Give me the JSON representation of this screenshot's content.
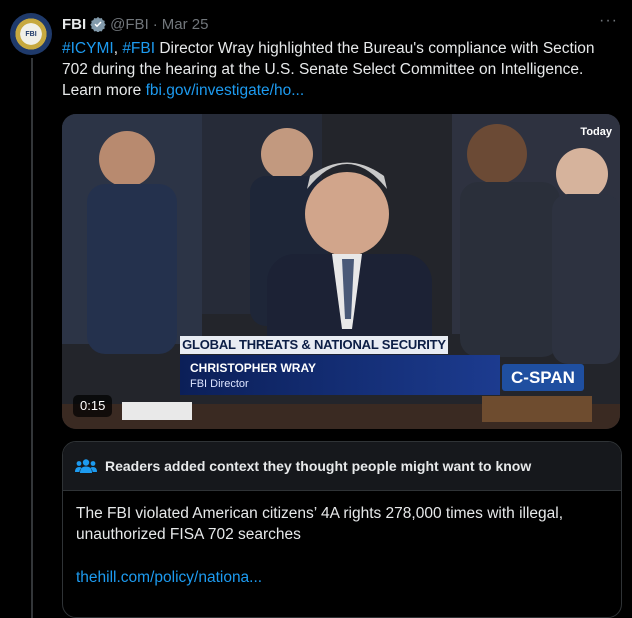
{
  "tweet": {
    "author_name": "FBI",
    "handle": "@FBI",
    "separator": "·",
    "date": "Mar 25",
    "more_label": "···",
    "verified_icon": "verified-badge-icon",
    "text_parts": {
      "tag1": "#ICYMI",
      "sep": ", ",
      "tag2": "#FBI",
      "body": " Director Wray highlighted the Bureau's compliance with Section 702 during the hearing at the U.S. Senate Select Committee on Intelligence. Learn more ",
      "link": "fbi.gov/investigate/ho..."
    },
    "avatar_icon": "fbi-seal-icon",
    "avatar_text": "FBI"
  },
  "media": {
    "badge_today": "Today",
    "banner_title": "GLOBAL THREATS & NATIONAL SECURITY",
    "banner_name": "CHRISTOPHER WRAY",
    "banner_role": "FBI Director",
    "network_logo": "C-SPAN",
    "duration": "0:15"
  },
  "community_note": {
    "icon": "people-icon",
    "header": "Readers added context they thought people might want to know",
    "body": "The FBI violated American citizens’ 4A rights 278,000 times with illegal, unauthorized FISA 702 searches",
    "link": "thehill.com/policy/nationa..."
  },
  "colors": {
    "accent": "#1d9bf0",
    "background": "#000000",
    "muted": "#71767b",
    "text": "#e7e9ea"
  }
}
